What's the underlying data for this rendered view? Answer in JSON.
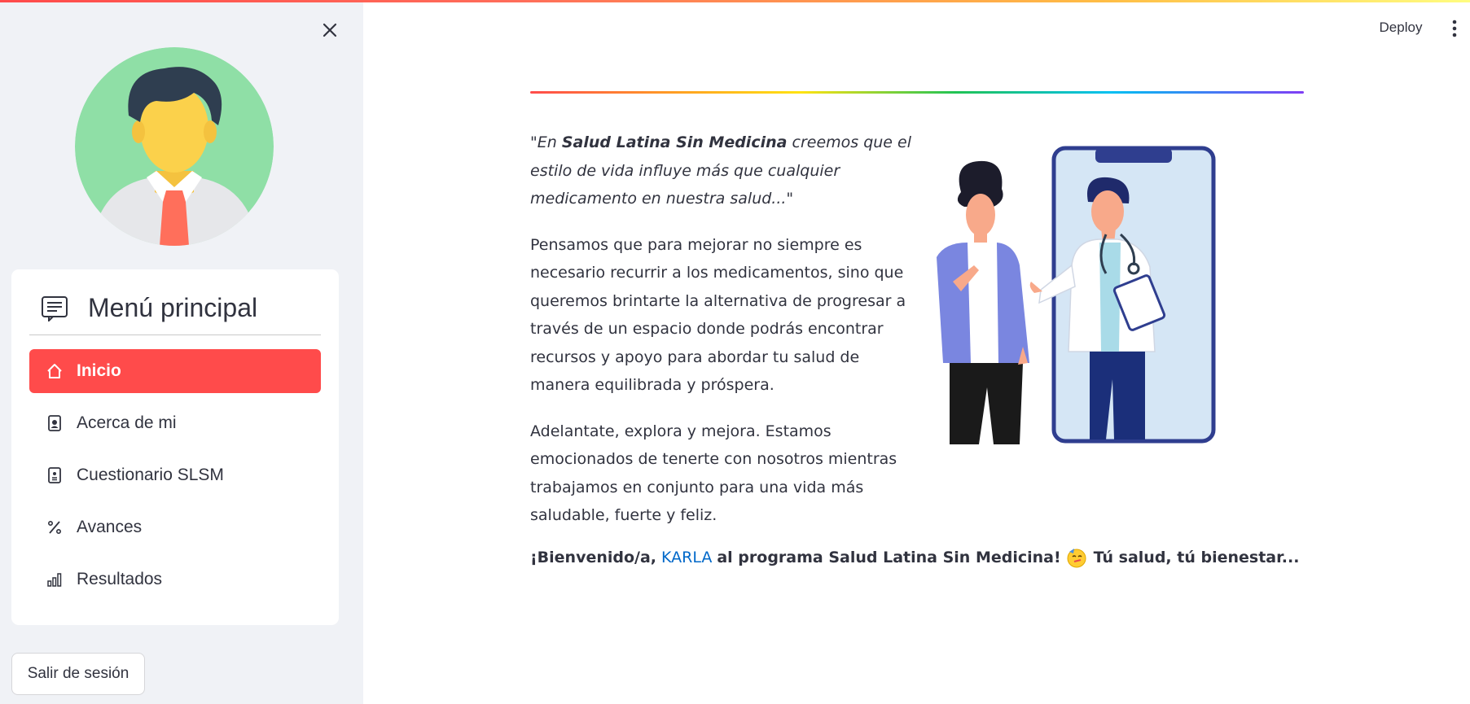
{
  "colors": {
    "accent": "#ff4b4b",
    "sidebar_bg": "#f0f2f6",
    "link": "#0068c9",
    "text": "#31333f"
  },
  "sidebar": {
    "close_icon": "close-icon",
    "avatar_icon": "user-avatar-icon",
    "menu": {
      "title": "Menú principal",
      "title_icon": "card-text-icon",
      "items": [
        {
          "label": "Inicio",
          "icon": "house-icon",
          "active": true
        },
        {
          "label": "Acerca de mi",
          "icon": "person-badge-icon",
          "active": false
        },
        {
          "label": "Cuestionario SLSM",
          "icon": "clipboard-icon",
          "active": false
        },
        {
          "label": "Avances",
          "icon": "percent-icon",
          "active": false
        },
        {
          "label": "Resultados",
          "icon": "bar-chart-icon",
          "active": false
        }
      ]
    },
    "logout_label": "Salir de sesión"
  },
  "header": {
    "deploy_label": "Deploy",
    "menu_icon": "kebab-menu-icon"
  },
  "main": {
    "quote_open": "\"En ",
    "quote_brand": "Salud Latina Sin Medicina",
    "quote_rest": " creemos que el estilo de vida influye más que cualquier medicamento en nuestra salud...\"",
    "paragraph_1": "Pensamos que para mejorar no siempre es necesario recurrir a los medicamentos, sino que queremos brintarte la alternativa de progresar a través de un espacio donde podrás encontrar recursos y apoyo para abordar tu salud de manera equilibrada y próspera.",
    "paragraph_2": "Adelantate, explora y mejora. Estamos emocionados de tenerte con nosotros mientras trabajamos en conjunto para una vida más saludable, fuerte y feliz.",
    "welcome_prefix": "¡Bienvenido/a,",
    "welcome_name": "KARLA",
    "welcome_middle": "al programa Salud Latina Sin Medicina!",
    "welcome_suffix": "Tú salud, tú bienestar...",
    "emoji_icon": "party-face-icon",
    "illustration_icon": "doctor-phone-illustration"
  }
}
